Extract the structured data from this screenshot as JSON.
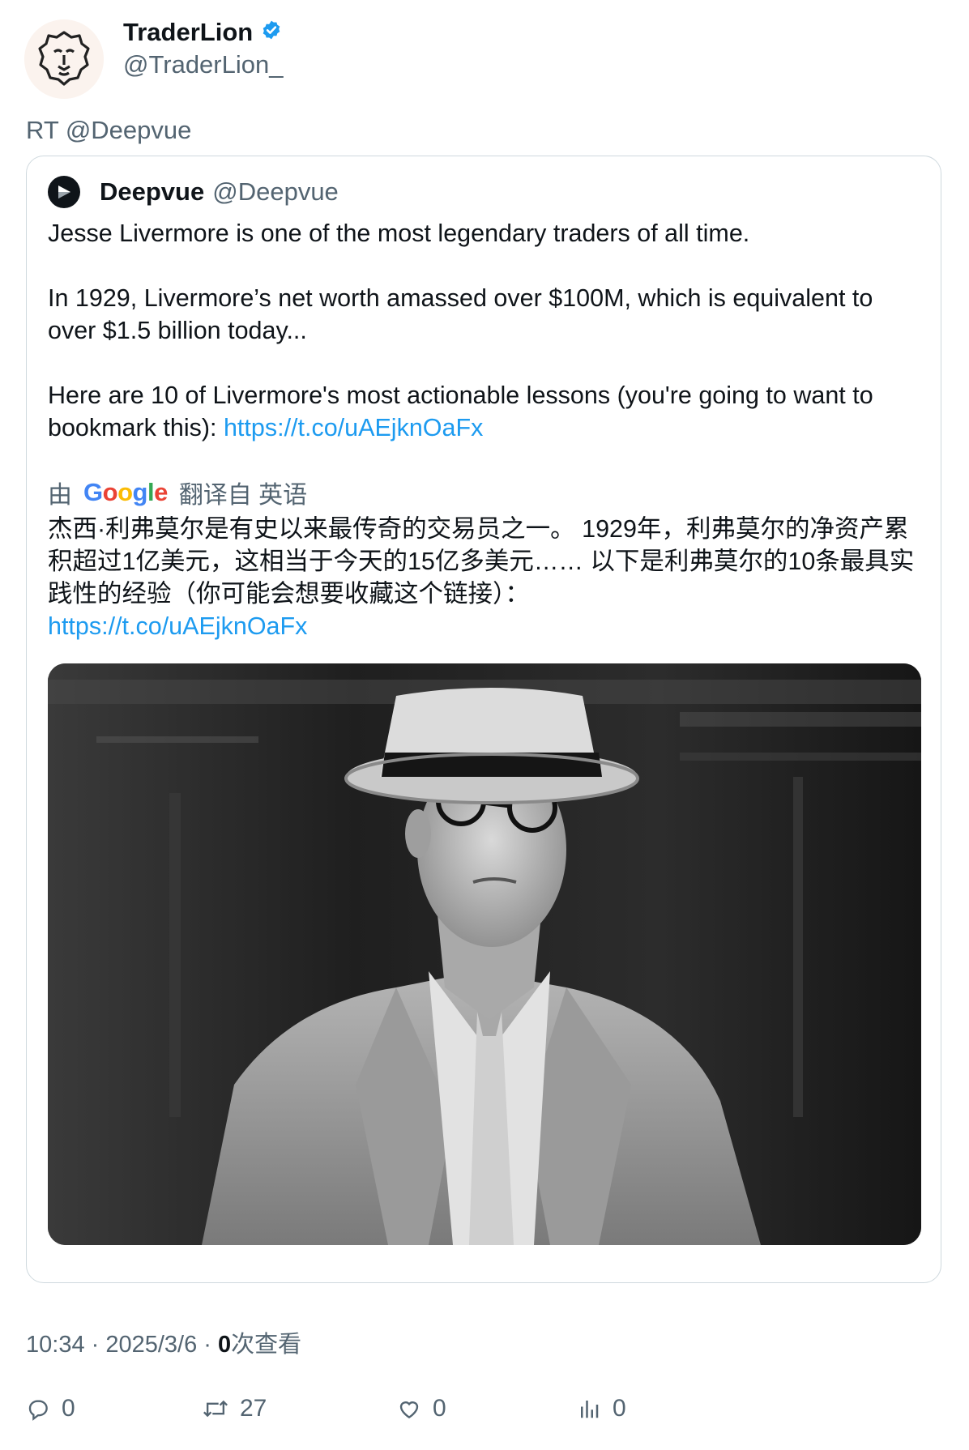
{
  "author": {
    "display_name": "TraderLion",
    "handle": "@TraderLion_",
    "verified_icon": "verified-badge-icon",
    "accent_color": "#1d9bf0"
  },
  "retweet_label": "RT @Deepvue",
  "quoted_tweet": {
    "display_name": "Deepvue",
    "handle": "@Deepvue",
    "text": "Jesse Livermore is one of the most legendary traders of all time.\n\nIn 1929, Livermore’s net worth amassed over $100M, which is equivalent to over $1.5 billion today...\n\nHere are 10 of Livermore's most actionable lessons (you're going to want to bookmark this): ",
    "link": "https://t.co/uAEjknOaFx",
    "translation": {
      "by_label": "由",
      "provider": "Google",
      "from_label": "翻译自 英语",
      "text": "杰西·利弗莫尔是有史以来最传奇的交易员之一。 1929年，利弗莫尔的净资产累积超过1亿美元，这相当于今天的15亿多美元…… 以下是利弗莫尔的10条最具实践性的经验（你可能会想要收藏这个链接）：",
      "link": "https://t.co/uAEjknOaFx"
    }
  },
  "meta": {
    "time_date": "10:34 · 2025/3/6 · ",
    "views_count": "0",
    "views_label": "次查看"
  },
  "actions": {
    "reply_count": "0",
    "retweet_count": "27",
    "like_count": "0",
    "views_count": "0"
  }
}
